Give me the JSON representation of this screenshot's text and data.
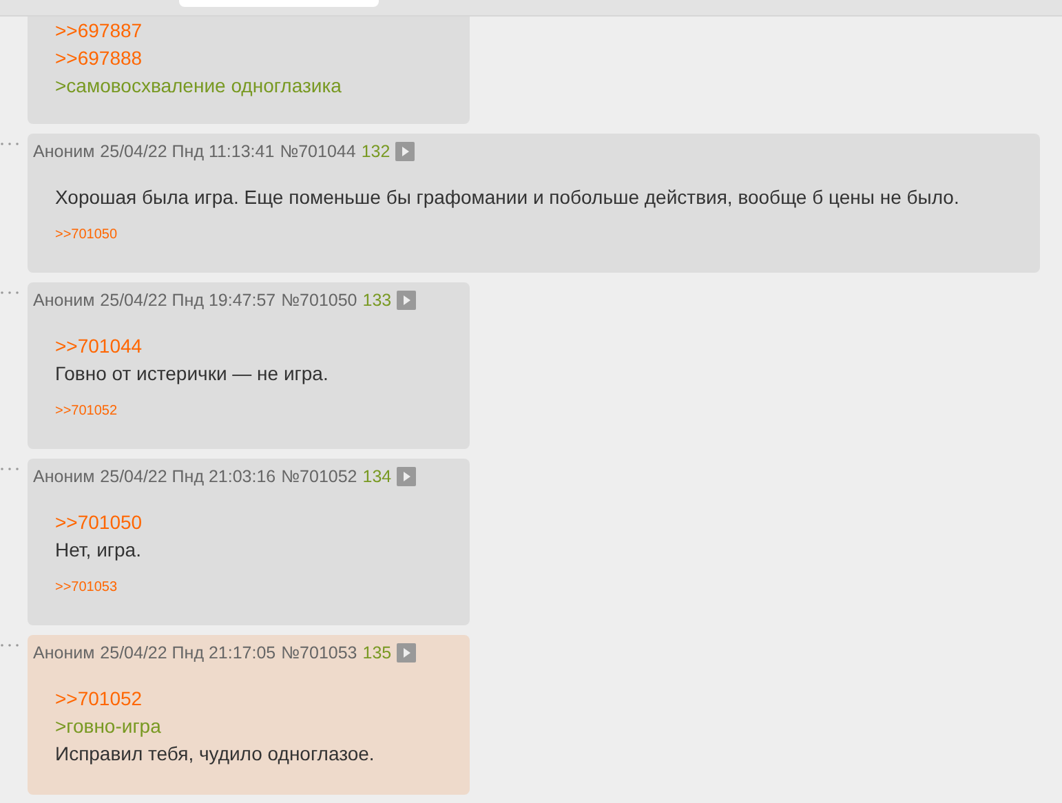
{
  "top_fragment": {
    "lines": [
      {
        "kind": "reply",
        "text": ">>697887"
      },
      {
        "kind": "reply",
        "text": ">>697888"
      },
      {
        "kind": "quote",
        "text": ">самовосхваление одноглазика"
      }
    ]
  },
  "posts": [
    {
      "author": "Аноним",
      "date": "25/04/22 Пнд 11:13:41",
      "number": "№701044",
      "index": "132",
      "highlighted": false,
      "wide": true,
      "lines": [
        {
          "kind": "text",
          "text": "Хорошая была игра. Еще поменьше бы графомании и побольше действия, вообще б цены не было."
        }
      ],
      "replies": [
        ">>701050"
      ]
    },
    {
      "author": "Аноним",
      "date": "25/04/22 Пнд 19:47:57",
      "number": "№701050",
      "index": "133",
      "highlighted": false,
      "wide": false,
      "lines": [
        {
          "kind": "reply",
          "text": ">>701044"
        },
        {
          "kind": "text",
          "text": "Говно от истерички — не игра."
        }
      ],
      "replies": [
        ">>701052"
      ]
    },
    {
      "author": "Аноним",
      "date": "25/04/22 Пнд 21:03:16",
      "number": "№701052",
      "index": "134",
      "highlighted": false,
      "wide": false,
      "lines": [
        {
          "kind": "reply",
          "text": ">>701050"
        },
        {
          "kind": "text",
          "text": "Нет, игра."
        }
      ],
      "replies": [
        ">>701053"
      ]
    },
    {
      "author": "Аноним",
      "date": "25/04/22 Пнд 21:17:05",
      "number": "№701053",
      "index": "135",
      "highlighted": true,
      "wide": false,
      "lines": [
        {
          "kind": "reply",
          "text": ">>701052"
        },
        {
          "kind": "quote",
          "text": ">говно-игра"
        },
        {
          "kind": "text",
          "text": "Исправил тебя, чудило одноглазое."
        }
      ]
    }
  ]
}
